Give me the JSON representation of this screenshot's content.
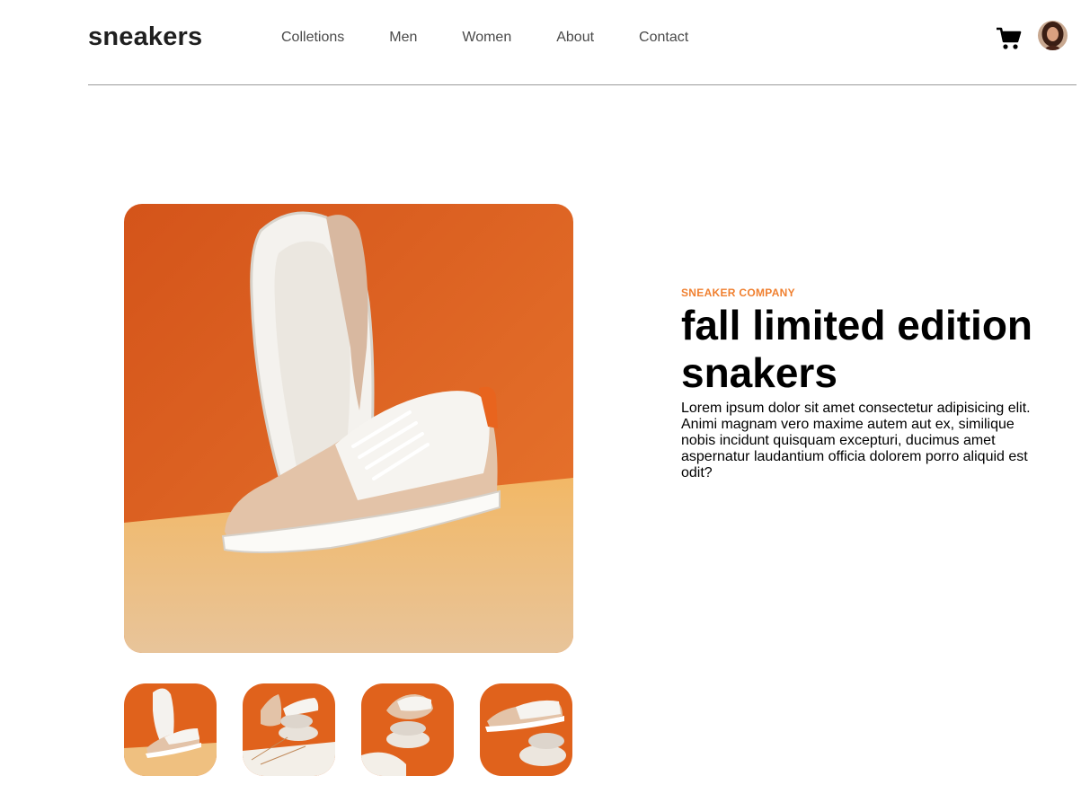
{
  "header": {
    "brand": "sneakers",
    "nav": [
      "Colletions",
      "Men",
      "Women",
      "About",
      "Contact"
    ],
    "cart_icon": "cart-icon",
    "avatar_icon": "user-avatar"
  },
  "product": {
    "company": "SNEAKER COMPANY",
    "title": "fall limited edition snakers",
    "description": "Lorem ipsum dolor sit amet consectetur adipisicing elit. Animi magnam vero maxime autem aut ex, similique nobis incidunt quisquam excepturi, ducimus amet aspernatur laudantium officia dolorem porro aliquid est odit?"
  },
  "colors": {
    "accent": "#f08030",
    "product_bg_orange": "#e0621c",
    "product_floor": "#f0c080"
  }
}
